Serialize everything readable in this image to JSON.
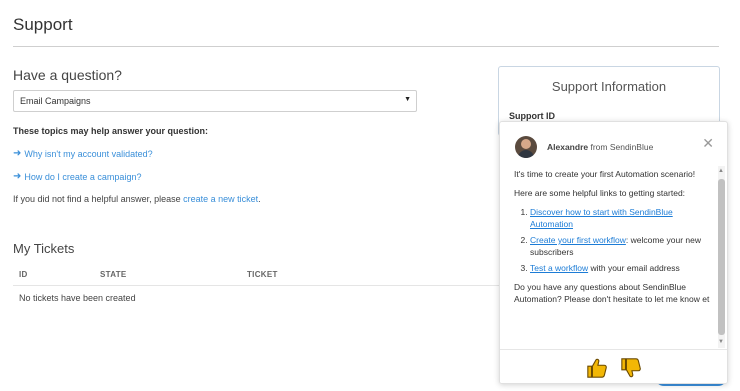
{
  "page": {
    "title": "Support"
  },
  "question": {
    "heading": "Have a question?",
    "select_value": "Email Campaigns",
    "topics_label": "These topics may help answer your question:",
    "links": [
      "Why isn't my account validated?",
      "How do I create a campaign?"
    ],
    "helpful_prefix": "If you did not find a helpful answer, please ",
    "helpful_link": "create a new ticket",
    "helpful_suffix": "."
  },
  "tickets": {
    "heading": "My Tickets",
    "columns": [
      "ID",
      "STATE",
      "TICKET"
    ],
    "empty_text": "No tickets have been created"
  },
  "support_card": {
    "title": "Support Information",
    "id_label": "Support ID"
  },
  "chat": {
    "sender_name": "Alexandre",
    "sender_suffix": " from SendinBlue",
    "intro": "It's time to create your first Automation scenario!",
    "links_intro": "Here are some helpful links to getting started:",
    "items": [
      {
        "link": "Discover how to start with SendinBlue Automation",
        "rest": ""
      },
      {
        "link": "Create your first workflow",
        "rest": ": welcome your new subscribers"
      },
      {
        "link": "Test a workflow",
        "rest": " with your email address"
      }
    ],
    "closing": "Do you have any questions about SendinBlue Automation? Please don't hesitate to let me know et"
  },
  "icons": {
    "arrow": "arrow-right-icon",
    "close": "close-icon",
    "thumbs_up": "thumbs-up-icon",
    "thumbs_down": "thumbs-down-icon"
  },
  "colors": {
    "link": "#3a8fd9",
    "accent": "#3b8fdc",
    "thumb": "#f2b705"
  }
}
